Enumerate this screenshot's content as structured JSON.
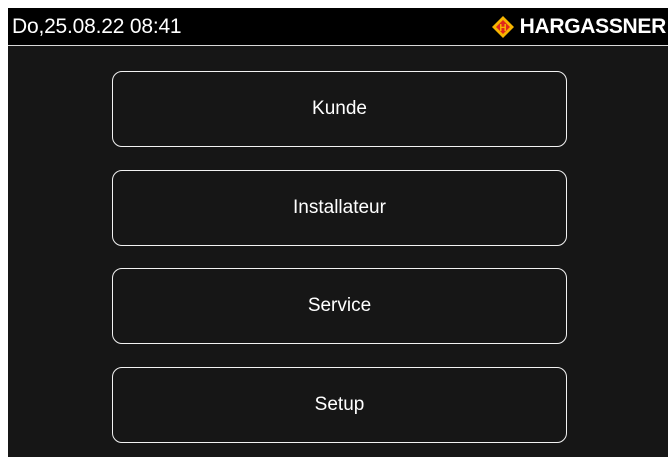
{
  "header": {
    "datetime": "Do,25.08.22 08:41",
    "brand": "HARGASSNER",
    "logo_icon": "hargassner-diamond-logo",
    "logo_letter": "H",
    "accent_color": "#f7b500",
    "logo_red": "#e0281b"
  },
  "menu": {
    "items": [
      {
        "label": "Kunde"
      },
      {
        "label": "Installateur"
      },
      {
        "label": "Service"
      },
      {
        "label": "Setup"
      }
    ]
  }
}
